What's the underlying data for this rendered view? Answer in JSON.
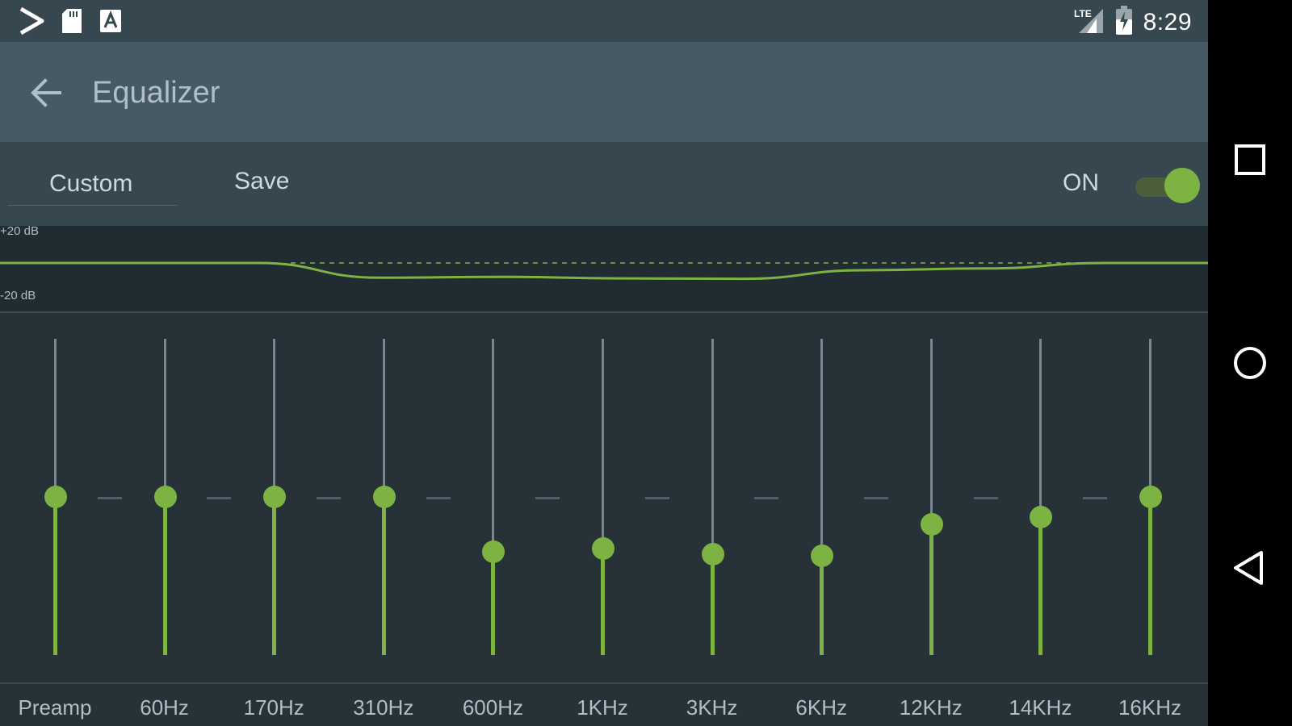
{
  "status_bar": {
    "time": "8:29",
    "left_icons": [
      "play-store-icon",
      "sd-card-icon",
      "text-a-icon"
    ],
    "right_icons": [
      "lte-signal-icon",
      "battery-charging-icon"
    ]
  },
  "app_bar": {
    "back_icon": "arrow-left-icon",
    "title": "Equalizer"
  },
  "toolbar": {
    "preset_label": "Custom",
    "save_label": "Save",
    "on_label": "ON",
    "enabled": true
  },
  "graph": {
    "top_label": "+20 dB",
    "bottom_label": "-20 dB"
  },
  "bands": [
    {
      "label": "Preamp",
      "level": 0.5
    },
    {
      "label": "60Hz",
      "level": 0.5
    },
    {
      "label": "170Hz",
      "level": 0.5
    },
    {
      "label": "310Hz",
      "level": 0.5
    },
    {
      "label": "600Hz",
      "level": 0.326
    },
    {
      "label": "1KHz",
      "level": 0.336
    },
    {
      "label": "3KHz",
      "level": 0.318
    },
    {
      "label": "6KHz",
      "level": 0.313
    },
    {
      "label": "12KHz",
      "level": 0.414
    },
    {
      "label": "14KHz",
      "level": 0.435
    },
    {
      "label": "16KHz",
      "level": 0.5
    }
  ],
  "colors": {
    "accent": "#7cb342",
    "background": "#263238",
    "app_bar": "#455a64",
    "toolbar": "#37474f",
    "nav_bar": "#000000"
  },
  "nav_bar": {
    "icons": [
      "recents-square-icon",
      "home-circle-icon",
      "back-triangle-icon"
    ]
  }
}
